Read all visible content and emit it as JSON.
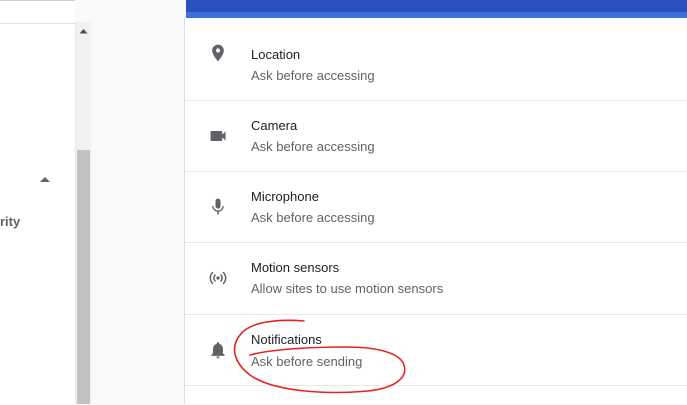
{
  "sidebar": {
    "label": "rity",
    "collapse_icon": "triangle-up-icon"
  },
  "scrollbar": {
    "up_icon": "scroll-up-arrow-icon"
  },
  "permissions": [
    {
      "icon": "location-pin-icon",
      "title": "Location",
      "subtitle": "Ask before accessing"
    },
    {
      "icon": "camera-icon",
      "title": "Camera",
      "subtitle": "Ask before accessing"
    },
    {
      "icon": "microphone-icon",
      "title": "Microphone",
      "subtitle": "Ask before accessing"
    },
    {
      "icon": "motion-sensors-icon",
      "title": "Motion sensors",
      "subtitle": "Allow sites to use motion sensors"
    },
    {
      "icon": "bell-icon",
      "title": "Notifications",
      "subtitle": "Ask before sending"
    }
  ],
  "colors": {
    "header": "#2a52be",
    "annotation": "#e8231f",
    "icon": "#5f6368",
    "title_text": "#202124",
    "subtitle_text": "#5f6368"
  }
}
